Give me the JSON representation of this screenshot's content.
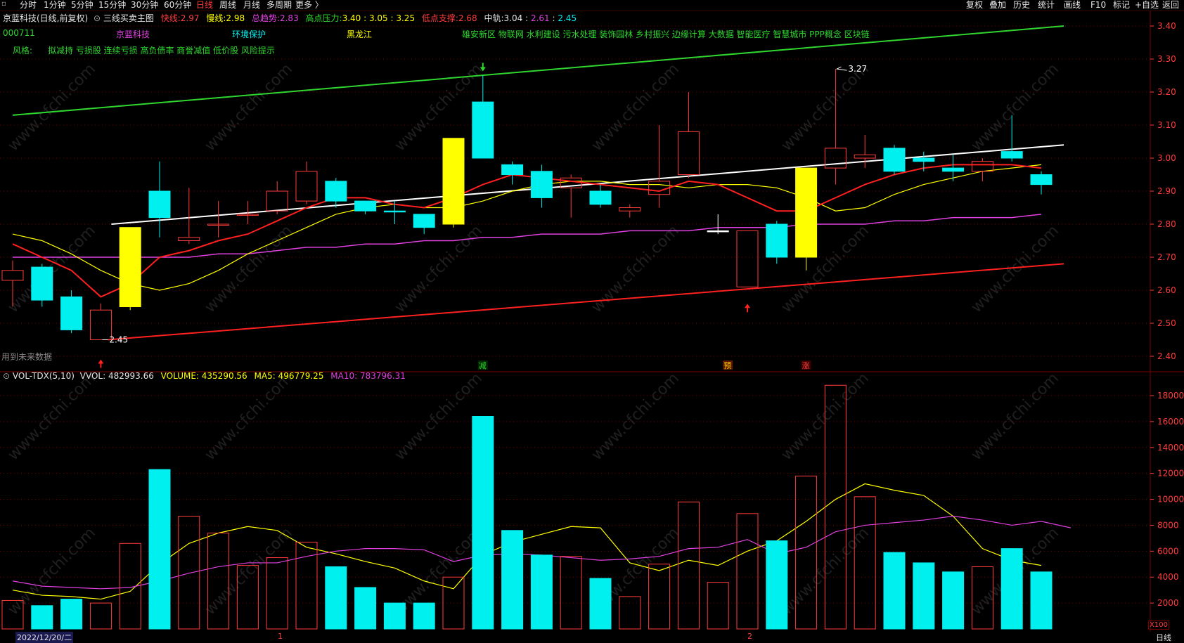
{
  "toolbar": {
    "left": [
      "分时",
      "1分钟",
      "5分钟",
      "15分钟",
      "30分钟",
      "60分钟",
      "日线",
      "周线",
      "月线",
      "多周期",
      "更多 〉"
    ],
    "active": "日线",
    "right": [
      "复权",
      "叠加",
      "历史",
      "统计",
      "画线",
      "F10",
      "标记",
      "+自选",
      "返回"
    ]
  },
  "header": {
    "stock": "京蓝科技(日线,前复权)",
    "indicator": "三线买卖主图",
    "fast_label": "快线:",
    "fast_value": "2.97",
    "slow_label": "慢线:",
    "slow_value": "2.98",
    "trend_label": "总趋势:",
    "trend_value": "2.83",
    "high_pressure_label": "高点压力:",
    "high_pressure_values": "3.40 : 3.05 : 3.25",
    "low_support_label": "低点支撑:",
    "low_support_value": "2.68",
    "mid_label": "中轨:",
    "mid_values": [
      "3.04",
      "2.61",
      "2.45"
    ]
  },
  "info": {
    "code": "000711",
    "name": "京蓝科技",
    "industry": "环境保护",
    "region": "黑龙江",
    "concepts": "雄安新区 物联网 水利建设 污水处理 装饰园林 乡村振兴 边缘计算 大数据 智能医疗 智慧城市 PPP概念 区块链",
    "style_label": "风格:",
    "styles": "拟减持 亏损股 连续亏损 高负债率 商誉减值 低价股 风险提示"
  },
  "annotations": {
    "future_data": "用到未来数据",
    "high_mark": "3.27",
    "low_mark": "2.45",
    "signal_reduce": "减",
    "signal_pre": "预",
    "signal_rise": "涨"
  },
  "volume_header": {
    "name": "VOL-TDX(5,10)",
    "vvol": "VVOL: 482993.66",
    "volume": "VOLUME: 435290.56",
    "ma5": "MA5: 496779.25",
    "ma10": "MA10: 783796.31"
  },
  "axes": {
    "price_ticks": [
      "3.40",
      "3.30",
      "3.20",
      "3.10",
      "3.00",
      "2.90",
      "2.80",
      "2.70",
      "2.60",
      "2.50",
      "2.40"
    ],
    "volume_ticks": [
      "18000",
      "16000",
      "14000",
      "12000",
      "10000",
      "8000",
      "6000",
      "4000",
      "2000"
    ],
    "volume_unit": "X100",
    "date_label": "2022/12/20/二",
    "month_marks": [
      "1",
      "2"
    ],
    "period_label": "日线"
  },
  "watermark": "www.cfchi.com",
  "colors": {
    "up": "#ff3c3c",
    "down": "#00f0f0",
    "yellow": "#ffff00",
    "green_line": "#2fd62f",
    "magenta": "#e040e0",
    "white": "#ffffff",
    "grid": "#7a0000"
  },
  "chart_data": {
    "type": "candlestick",
    "price_range": [
      2.4,
      3.4
    ],
    "volume_range": [
      0,
      19000
    ],
    "candles": [
      {
        "o": 2.63,
        "c": 2.66,
        "h": 2.69,
        "l": 2.55,
        "v": 2200,
        "t": "up"
      },
      {
        "o": 2.67,
        "c": 2.57,
        "h": 2.68,
        "l": 2.55,
        "v": 1800,
        "t": "down"
      },
      {
        "o": 2.58,
        "c": 2.48,
        "h": 2.6,
        "l": 2.47,
        "v": 2300,
        "t": "down"
      },
      {
        "o": 2.45,
        "c": 2.54,
        "h": 2.56,
        "l": 2.45,
        "v": 2000,
        "t": "up"
      },
      {
        "o": 2.55,
        "c": 2.79,
        "h": 2.79,
        "l": 2.54,
        "v": 6600,
        "t": "yellow"
      },
      {
        "o": 2.82,
        "c": 2.9,
        "h": 2.99,
        "l": 2.76,
        "v": 12300,
        "t": "down"
      },
      {
        "o": 2.76,
        "c": 2.75,
        "h": 2.91,
        "l": 2.74,
        "v": 8700,
        "t": "up"
      },
      {
        "o": 2.8,
        "c": 2.8,
        "h": 2.87,
        "l": 2.76,
        "v": 7400,
        "t": "up"
      },
      {
        "o": 2.83,
        "c": 2.83,
        "h": 2.87,
        "l": 2.8,
        "v": 4900,
        "t": "up"
      },
      {
        "o": 2.84,
        "c": 2.9,
        "h": 2.93,
        "l": 2.83,
        "v": 5500,
        "t": "up"
      },
      {
        "o": 2.87,
        "c": 2.96,
        "h": 2.99,
        "l": 2.86,
        "v": 6700,
        "t": "up"
      },
      {
        "o": 2.93,
        "c": 2.87,
        "h": 2.94,
        "l": 2.85,
        "v": 4800,
        "t": "down"
      },
      {
        "o": 2.87,
        "c": 2.84,
        "h": 2.87,
        "l": 2.83,
        "v": 3200,
        "t": "down"
      },
      {
        "o": 2.84,
        "c": 2.84,
        "h": 2.87,
        "l": 2.8,
        "v": 2000,
        "t": "down"
      },
      {
        "o": 2.83,
        "c": 2.79,
        "h": 2.83,
        "l": 2.77,
        "v": 2000,
        "t": "down"
      },
      {
        "o": 2.8,
        "c": 3.06,
        "h": 3.06,
        "l": 2.79,
        "v": 4000,
        "t": "yellow"
      },
      {
        "o": 3.17,
        "c": 3.0,
        "h": 3.25,
        "l": 3.0,
        "v": 16400,
        "t": "down"
      },
      {
        "o": 2.98,
        "c": 2.95,
        "h": 2.99,
        "l": 2.92,
        "v": 7600,
        "t": "down"
      },
      {
        "o": 2.96,
        "c": 2.88,
        "h": 2.98,
        "l": 2.85,
        "v": 5700,
        "t": "down"
      },
      {
        "o": 2.91,
        "c": 2.94,
        "h": 2.95,
        "l": 2.82,
        "v": 5600,
        "t": "up"
      },
      {
        "o": 2.9,
        "c": 2.86,
        "h": 2.92,
        "l": 2.85,
        "v": 3900,
        "t": "down"
      },
      {
        "o": 2.84,
        "c": 2.85,
        "h": 2.86,
        "l": 2.82,
        "v": 2500,
        "t": "up"
      },
      {
        "o": 2.89,
        "c": 2.93,
        "h": 3.1,
        "l": 2.85,
        "v": 5000,
        "t": "up"
      },
      {
        "o": 2.95,
        "c": 3.08,
        "h": 3.2,
        "l": 2.94,
        "v": 9800,
        "t": "up"
      },
      {
        "o": 2.78,
        "c": 2.78,
        "h": 2.83,
        "l": 2.77,
        "v": 3600,
        "t": "white"
      },
      {
        "o": 2.61,
        "c": 2.78,
        "h": 2.78,
        "l": 2.61,
        "v": 8900,
        "t": "up"
      },
      {
        "o": 2.8,
        "c": 2.7,
        "h": 2.81,
        "l": 2.68,
        "v": 6800,
        "t": "down"
      },
      {
        "o": 2.7,
        "c": 2.97,
        "h": 2.97,
        "l": 2.66,
        "v": 11800,
        "t": "yellow"
      },
      {
        "o": 2.97,
        "c": 3.03,
        "h": 3.27,
        "l": 2.92,
        "v": 18800,
        "t": "up"
      },
      {
        "o": 3.0,
        "c": 3.01,
        "h": 3.07,
        "l": 2.97,
        "v": 10200,
        "t": "up"
      },
      {
        "o": 3.03,
        "c": 2.96,
        "h": 3.04,
        "l": 2.95,
        "v": 5900,
        "t": "down"
      },
      {
        "o": 3.0,
        "c": 2.99,
        "h": 3.02,
        "l": 2.96,
        "v": 5100,
        "t": "down"
      },
      {
        "o": 2.97,
        "c": 2.96,
        "h": 3.01,
        "l": 2.93,
        "v": 4400,
        "t": "down"
      },
      {
        "o": 2.96,
        "c": 2.99,
        "h": 3.0,
        "l": 2.93,
        "v": 4800,
        "t": "up"
      },
      {
        "o": 3.02,
        "c": 3.0,
        "h": 3.13,
        "l": 2.99,
        "v": 6200,
        "t": "down"
      },
      {
        "o": 2.95,
        "c": 2.92,
        "h": 2.96,
        "l": 2.89,
        "v": 4400,
        "t": "down"
      }
    ],
    "fast_line": [
      2.74,
      2.7,
      2.66,
      2.58,
      2.62,
      2.7,
      2.72,
      2.75,
      2.77,
      2.81,
      2.85,
      2.88,
      2.88,
      2.86,
      2.85,
      2.88,
      2.92,
      2.95,
      2.94,
      2.93,
      2.92,
      2.91,
      2.9,
      2.93,
      2.92,
      2.88,
      2.84,
      2.84,
      2.88,
      2.92,
      2.95,
      2.97,
      2.98,
      2.98,
      2.98,
      2.97
    ],
    "slow_line": [
      2.77,
      2.75,
      2.71,
      2.66,
      2.62,
      2.6,
      2.62,
      2.66,
      2.71,
      2.75,
      2.79,
      2.83,
      2.85,
      2.86,
      2.85,
      2.85,
      2.87,
      2.9,
      2.92,
      2.93,
      2.93,
      2.92,
      2.92,
      2.91,
      2.92,
      2.92,
      2.91,
      2.88,
      2.84,
      2.85,
      2.89,
      2.92,
      2.94,
      2.96,
      2.97,
      2.98
    ],
    "trend_line": [
      2.7,
      2.7,
      2.7,
      2.7,
      2.7,
      2.7,
      2.7,
      2.71,
      2.71,
      2.72,
      2.73,
      2.73,
      2.74,
      2.74,
      2.75,
      2.75,
      2.76,
      2.76,
      2.77,
      2.77,
      2.77,
      2.78,
      2.78,
      2.78,
      2.79,
      2.79,
      2.79,
      2.8,
      2.8,
      2.8,
      2.81,
      2.81,
      2.82,
      2.82,
      2.82,
      2.83
    ],
    "channel_top": [
      3.13,
      3.4
    ],
    "channel_bottom": [
      2.45,
      2.68
    ],
    "white_line": [
      2.8,
      3.04
    ],
    "vol_ma5": [
      3000,
      2600,
      2500,
      2300,
      2900,
      5000,
      6600,
      7400,
      7900,
      7600,
      6300,
      5800,
      5200,
      4700,
      3700,
      3100,
      5700,
      6700,
      7300,
      7900,
      7800,
      5100,
      4500,
      5300,
      4900,
      6000,
      6800,
      8300,
      10000,
      11200,
      10700,
      10300,
      8700,
      6200,
      5300,
      4900
    ],
    "vol_ma10": [
      3700,
      3300,
      3200,
      3100,
      3200,
      3700,
      4300,
      4800,
      5100,
      5100,
      5600,
      6000,
      6200,
      6200,
      6100,
      5200,
      5700,
      5800,
      5700,
      5500,
      5300,
      5400,
      5600,
      6200,
      6300,
      6900,
      5800,
      6300,
      7500,
      8000,
      8200,
      8400,
      8700,
      8400,
      8000,
      8300,
      7800
    ]
  }
}
